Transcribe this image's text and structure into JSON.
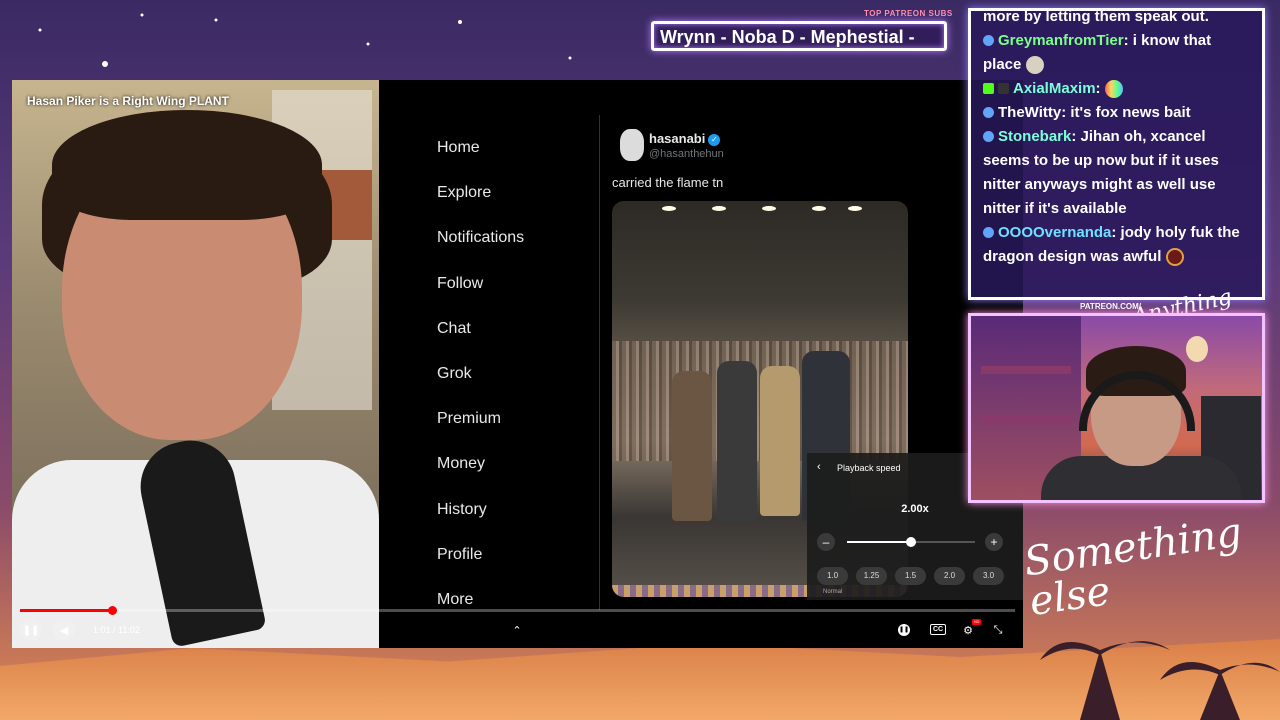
{
  "overlay": {
    "subs_label": "TOP PATREON SUBS",
    "subs_ticker": "Wrynn -  Noba D - Mephestial -",
    "patreon_tag": "PATREON.COM/",
    "logo_top": "Anything else",
    "logo_big": "Something else"
  },
  "video": {
    "title": "Hasan Piker is a Right Wing PLANT",
    "time": "1:01 / 11:02",
    "progress_fraction": 0.092
  },
  "twitter": {
    "nav": [
      "Home",
      "Explore",
      "Notifications",
      "Follow",
      "Chat",
      "Grok",
      "Premium",
      "Money",
      "History",
      "Profile",
      "More"
    ],
    "tweet": {
      "name": "hasanabi",
      "handle": "@hasanthehun",
      "text": "carried the flame tn"
    }
  },
  "speed_menu": {
    "header": "Playback speed",
    "value": "2.00x",
    "value_fraction": 0.5,
    "presets": [
      "1.0",
      "1.25",
      "1.5",
      "2.0",
      "3.0"
    ],
    "normal_label": "Normal"
  },
  "controls": {
    "cc_label": "CC",
    "hd_badge": "HD"
  },
  "chat": {
    "lines": [
      {
        "user": "",
        "text": "more by letting them speak out.",
        "color": "#ffffff",
        "badge": false
      },
      {
        "user": "GreymanfromTier",
        "text": ": i know that place",
        "color": "#7CFF8A",
        "badge": true
      },
      {
        "user": "AxialMaxim",
        "text": ":",
        "color": "#7CFF8A",
        "badge": true
      },
      {
        "user": "TheWitty",
        "text": ": it's fox news bait",
        "color": "#ffffff",
        "badge": true
      },
      {
        "user": "Stonebark",
        "text": ": Jihan oh, xcancel seems to be up now but if it uses nitter anyways might as well use nitter if it's available",
        "color": "#7CFFD8",
        "badge": true
      },
      {
        "user": "OOOOvernanda",
        "text": ": jody holy fuk the dragon design was awful",
        "color": "#6FE0FF",
        "badge": true
      }
    ]
  }
}
